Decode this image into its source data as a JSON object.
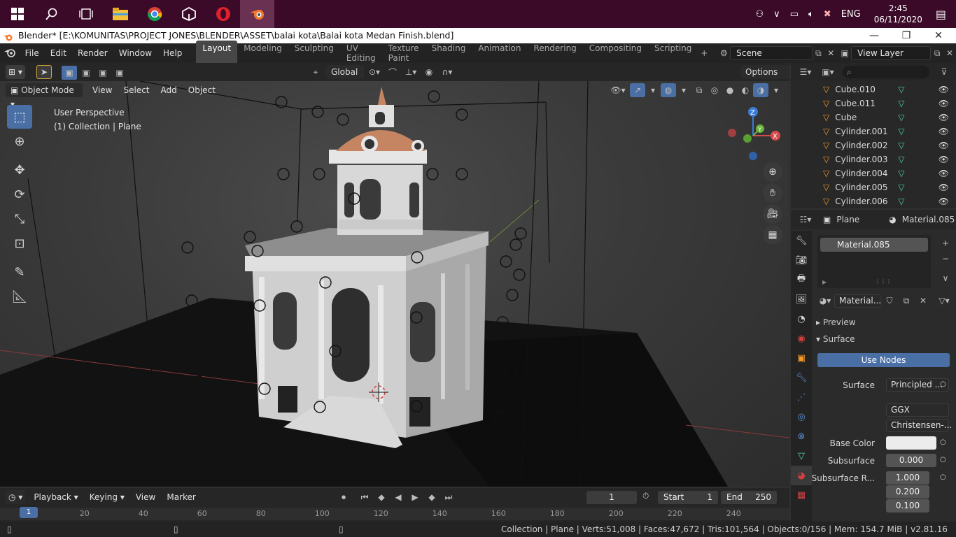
{
  "taskbar": {
    "apps": [
      "windows-start",
      "search",
      "task-view",
      "file-explorer",
      "chrome",
      "unity",
      "opera",
      "blender"
    ],
    "lang": "ENG",
    "time": "2:45",
    "date": "06/11/2020"
  },
  "window": {
    "title": "Blender* [E:\\KOMUNITAS\\PROJECT JONES\\BLENDER\\ASSET\\balai kota\\Balai kota Medan Finish.blend]"
  },
  "menubar": {
    "menus": [
      "File",
      "Edit",
      "Render",
      "Window",
      "Help"
    ],
    "workspaces": [
      "Layout",
      "Modeling",
      "Sculpting",
      "UV Editing",
      "Texture Paint",
      "Shading",
      "Animation",
      "Rendering",
      "Compositing",
      "Scripting"
    ],
    "active_workspace": "Layout",
    "scene": "Scene",
    "view_layer": "View Layer"
  },
  "viewport_header": {
    "transform_orientation": "Global",
    "options": "Options",
    "mode": "Object Mode",
    "menus": [
      "View",
      "Select",
      "Add",
      "Object"
    ]
  },
  "viewport": {
    "overlay_line1": "User Perspective",
    "overlay_line2": "(1) Collection | Plane",
    "gizmo": {
      "x": "X",
      "y": "Y",
      "z": "Z"
    }
  },
  "timeline": {
    "menus": [
      "Playback",
      "Keying",
      "View",
      "Marker"
    ],
    "current_frame": "1",
    "start_label": "Start",
    "start": "1",
    "end_label": "End",
    "end": "250",
    "ticks": [
      "1",
      "20",
      "40",
      "60",
      "80",
      "100",
      "120",
      "140",
      "160",
      "180",
      "200",
      "220",
      "240"
    ]
  },
  "outliner": {
    "items": [
      {
        "name": "Cube.010"
      },
      {
        "name": "Cube.011"
      },
      {
        "name": "Cube"
      },
      {
        "name": "Cylinder.001"
      },
      {
        "name": "Cylinder.002"
      },
      {
        "name": "Cylinder.003"
      },
      {
        "name": "Cylinder.004"
      },
      {
        "name": "Cylinder.005"
      },
      {
        "name": "Cylinder.006"
      }
    ]
  },
  "properties": {
    "object": "Plane",
    "material": "Material.085",
    "slot": "Material.085",
    "material_field": "Material...",
    "preview": "Preview",
    "surface_panel": "Surface",
    "use_nodes": "Use Nodes",
    "surface_label": "Surface",
    "surface_value": "Principled ...",
    "distribution": "GGX",
    "subsurface_method": "Christensen-...",
    "base_color_label": "Base Color",
    "subsurface_label": "Subsurface",
    "subsurface_value": "0.000",
    "subsurface_r_label": "Subsurface R...",
    "subsurface_r": [
      "1.000",
      "0.200",
      "0.100"
    ]
  },
  "statusbar": {
    "text": "Collection | Plane | Verts:51,008 | Faces:47,672 | Tris:101,564 | Objects:0/156 | Mem: 154.7 MiB | v2.81.16"
  },
  "colors": {
    "accent": "#4a6fa5",
    "taskbar": "#3b0a28",
    "mesh": "#4fd1a0"
  }
}
